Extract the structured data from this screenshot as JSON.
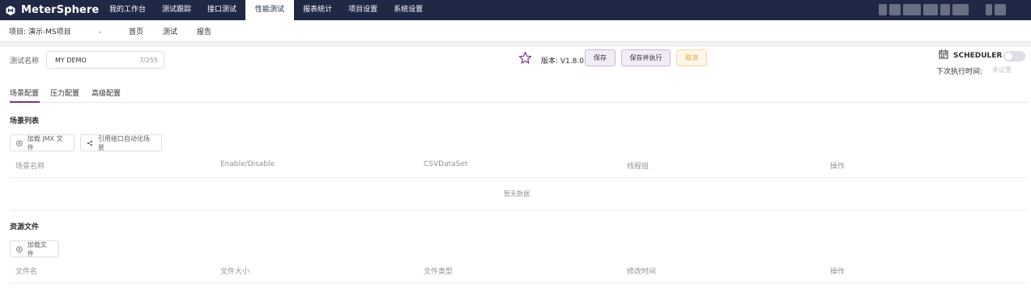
{
  "app": {
    "logo_text": "MeterSphere"
  },
  "topnav": {
    "items": [
      {
        "label": "我的工作台"
      },
      {
        "label": "测试跟踪"
      },
      {
        "label": "接口测试"
      },
      {
        "label": "性能测试"
      },
      {
        "label": "报表统计"
      },
      {
        "label": "项目设置"
      },
      {
        "label": "系统设置"
      }
    ],
    "active_index": 3
  },
  "subbar": {
    "project_label": "项目: 演示-MS项目",
    "items": [
      {
        "label": "首页"
      },
      {
        "label": "测试"
      },
      {
        "label": "报告"
      }
    ]
  },
  "form": {
    "name_label": "测试名称",
    "name_value": "MY DEMO",
    "name_count": "7/255",
    "version_label": "版本: V1.8.0",
    "save_label": "保存",
    "save_run_label": "保存并执行",
    "cancel_label": "取消",
    "scheduler_label": "SCHEDULER",
    "scheduler_enabled": false,
    "next_run_label": "下次执行时间:",
    "next_run_value": "未设置"
  },
  "tabs": [
    {
      "label": "场景配置"
    },
    {
      "label": "压力配置"
    },
    {
      "label": "高级配置"
    }
  ],
  "scenario": {
    "title": "场景列表",
    "load_jmx_label": "加载 JMX 文件",
    "ref_api_label": "引用接口自动化场景",
    "columns": [
      "场景名称",
      "Enable/Disable",
      "CSVDataSet",
      "线程组",
      "操作"
    ],
    "empty_text": "暂无数据"
  },
  "resources": {
    "title": "资源文件",
    "load_file_label": "加载文件",
    "columns": [
      "文件名",
      "文件大小",
      "文件类型",
      "修改时间",
      "操作"
    ]
  },
  "colors": {
    "nav_bg": "#1f2845",
    "accent": "#783887",
    "warning": "#e6a23c"
  }
}
